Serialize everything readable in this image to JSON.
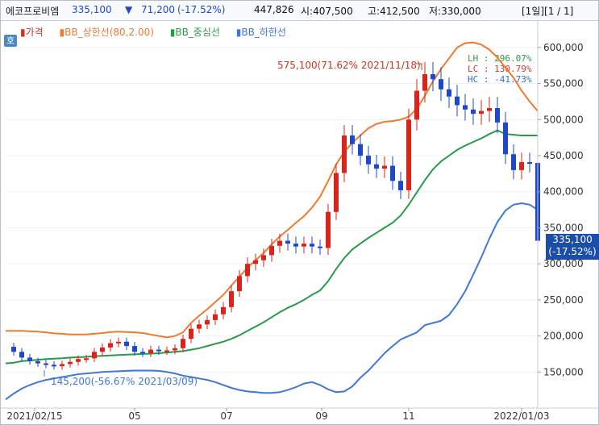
{
  "header": {
    "stock_name": "에코프로비엠",
    "price": "335,100",
    "down_arrow": "▼",
    "change": "71,200",
    "change_pct": "(-17.52%)",
    "volume": "447,826",
    "open": "시:407,500",
    "high": "고:412,500",
    "low": "저:330,000",
    "page_info": "[1일][1 / 1]",
    "color_up": "#e23b2d",
    "color_down": "#1e49c8"
  },
  "chart_data": {
    "type": "line",
    "legend": [
      {
        "name": "가격",
        "color": "#c8341f"
      },
      {
        "name": "BB_상한선(80,2.00)",
        "color": "#ef7a2f"
      },
      {
        "name": "BB_중심선",
        "color": "#2b9a48"
      },
      {
        "name": "BB_하한선",
        "color": "#3f78d6"
      }
    ],
    "x_ticks": [
      "2021/02/15",
      "05",
      "07",
      "09",
      "11",
      "2022/01/03"
    ],
    "y_ticks": [
      "600,000",
      "550,000",
      "500,000",
      "450,000",
      "400,000",
      "350,000",
      "300,000",
      "250,000",
      "200,000",
      "150,000"
    ],
    "ylim": [
      100000,
      620000
    ],
    "annotations": {
      "high_label": "575,100(71.62% 2021/11/18)",
      "low_label": "145,200(-56.67% 2021/03/09)"
    },
    "stats": {
      "lh": "LH : 296.07%",
      "lc": "LC : 130.79%",
      "hc": "HC : -41.73%"
    },
    "current_price": "335,100",
    "current_change": "(-17.52%)",
    "series": [
      {
        "name": "BB_상한선(80,2.00)",
        "color": "#ef7a2f",
        "x": [
          0,
          10,
          20,
          30,
          40,
          50,
          60,
          70,
          80,
          90,
          100,
          110,
          120,
          130,
          140,
          150,
          160,
          170,
          180,
          190,
          200,
          210,
          220,
          230,
          240,
          250,
          260,
          270,
          280,
          290,
          300,
          310,
          320,
          330,
          340,
          350,
          360,
          370,
          380,
          390,
          400,
          410,
          420,
          430,
          440,
          450,
          460,
          470,
          480,
          490,
          500,
          510,
          520,
          530,
          540,
          550,
          560,
          570,
          580,
          590,
          600,
          610,
          620,
          630,
          640,
          650,
          660
        ],
        "values": [
          207000,
          207000,
          207000,
          206500,
          206000,
          205000,
          203500,
          203000,
          202000,
          202000,
          202000,
          203000,
          204000,
          205500,
          206000,
          205500,
          205000,
          204000,
          202000,
          200000,
          198000,
          200000,
          205000,
          218000,
          228000,
          237000,
          247000,
          257000,
          270000,
          282000,
          295000,
          305000,
          315000,
          327000,
          338000,
          347000,
          357000,
          366000,
          378000,
          393000,
          415000,
          438000,
          455000,
          468000,
          478000,
          488000,
          494000,
          497000,
          498000,
          500000,
          504000,
          515000,
          533000,
          553000,
          570000,
          585000,
          600000,
          606000,
          607000,
          604000,
          597000,
          586000,
          572000,
          558000,
          540000,
          525000,
          512000
        ]
      },
      {
        "name": "BB_중심선",
        "color": "#2b9a48",
        "x": [
          0,
          10,
          20,
          30,
          40,
          50,
          60,
          70,
          80,
          90,
          100,
          110,
          120,
          130,
          140,
          150,
          160,
          170,
          180,
          190,
          200,
          210,
          220,
          230,
          240,
          250,
          260,
          270,
          280,
          290,
          300,
          310,
          320,
          330,
          340,
          350,
          360,
          370,
          380,
          390,
          400,
          410,
          420,
          430,
          440,
          450,
          460,
          470,
          480,
          490,
          500,
          510,
          520,
          530,
          540,
          550,
          560,
          570,
          580,
          590,
          600,
          610,
          620,
          630,
          640,
          650,
          660
        ],
        "values": [
          162000,
          163000,
          165000,
          166000,
          167000,
          168000,
          168500,
          169000,
          170000,
          170500,
          171000,
          172000,
          172500,
          173000,
          173500,
          174000,
          174500,
          175000,
          175500,
          176000,
          177000,
          178000,
          179000,
          181000,
          183000,
          186000,
          189000,
          192000,
          196000,
          201000,
          207000,
          213000,
          219000,
          226000,
          233000,
          239000,
          244000,
          250000,
          257000,
          263000,
          276000,
          293000,
          308000,
          320000,
          328000,
          336000,
          343000,
          350000,
          357000,
          367000,
          382000,
          399000,
          416000,
          431000,
          442000,
          450000,
          458000,
          464000,
          469000,
          474000,
          480000,
          485000,
          480000,
          479000,
          478000,
          478000,
          478000
        ]
      },
      {
        "name": "BB_하한선",
        "color": "#3f78d6",
        "x": [
          0,
          10,
          20,
          30,
          40,
          50,
          60,
          70,
          80,
          90,
          100,
          110,
          120,
          130,
          140,
          150,
          160,
          170,
          180,
          190,
          200,
          210,
          220,
          230,
          240,
          250,
          260,
          270,
          280,
          290,
          300,
          310,
          320,
          330,
          340,
          350,
          360,
          370,
          380,
          390,
          400,
          410,
          420,
          430,
          440,
          450,
          460,
          470,
          480,
          490,
          500,
          510,
          520,
          530,
          540,
          550,
          560,
          570,
          580,
          590,
          600,
          610,
          620,
          630,
          640,
          650,
          660
        ],
        "values": [
          112000,
          120000,
          127000,
          132000,
          136000,
          139000,
          141000,
          143000,
          145000,
          147000,
          148000,
          149000,
          150000,
          150500,
          151000,
          151500,
          152000,
          152000,
          152000,
          151500,
          150000,
          148000,
          145000,
          143000,
          141000,
          139000,
          136000,
          132000,
          128000,
          125000,
          123000,
          122000,
          121000,
          121000,
          122000,
          125000,
          129000,
          134000,
          136000,
          132000,
          126000,
          122000,
          123000,
          130000,
          142000,
          152000,
          164000,
          176000,
          186000,
          195000,
          200000,
          205000,
          215000,
          218000,
          221000,
          229000,
          244000,
          262000,
          285000,
          309000,
          335000,
          358000,
          374000,
          382000,
          384000,
          382000,
          375000
        ]
      },
      {
        "name": "가격",
        "color": "#c8341f",
        "x": [
          0,
          10,
          20,
          30,
          40,
          50,
          60,
          70,
          80,
          90,
          100,
          110,
          120,
          130,
          140,
          150,
          160,
          170,
          180,
          190,
          200,
          210,
          220,
          230,
          240,
          250,
          260,
          270,
          280,
          290,
          300,
          310,
          320,
          330,
          340,
          350,
          360,
          370,
          380,
          390,
          400,
          410,
          420,
          430,
          440,
          450,
          460,
          470,
          480,
          490,
          500,
          510,
          520,
          530,
          540,
          550,
          560,
          570,
          580,
          590,
          600,
          610,
          620,
          630,
          640,
          650,
          660
        ],
        "values": [
          185000,
          178000,
          170000,
          165000,
          162000,
          160000,
          158000,
          161000,
          164000,
          168000,
          169000,
          178000,
          184000,
          190000,
          192000,
          186000,
          178000,
          176000,
          181000,
          179000,
          180000,
          183000,
          196000,
          210000,
          216000,
          222000,
          230000,
          240000,
          262000,
          283000,
          300000,
          305000,
          312000,
          325000,
          332000,
          328000,
          324000,
          328000,
          324000,
          322000,
          372000,
          426000,
          478000,
          466000,
          450000,
          438000,
          432000,
          436000,
          415000,
          402000,
          500000,
          540000,
          563000,
          556000,
          542000,
          532000,
          520000,
          514000,
          508000,
          512000,
          516000,
          496000,
          452000,
          430000,
          441000,
          440000,
          398000
        ]
      }
    ]
  }
}
